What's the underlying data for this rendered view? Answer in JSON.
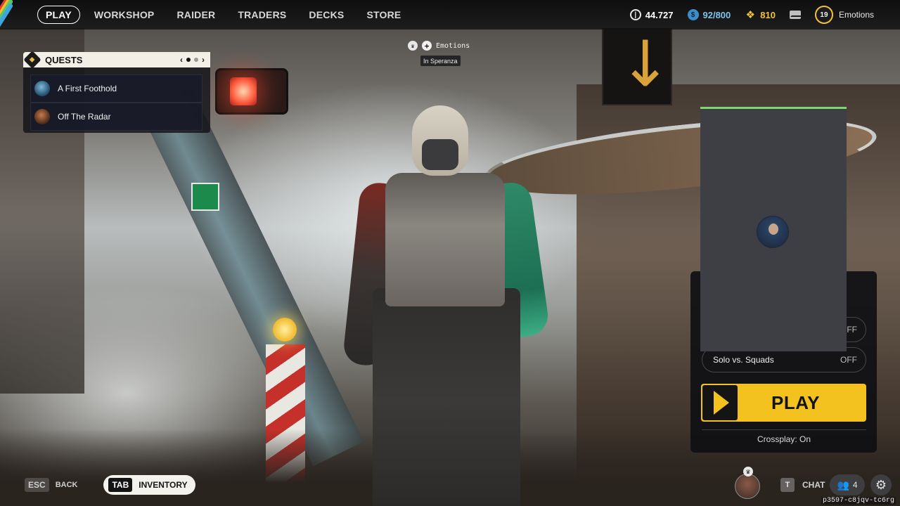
{
  "nav": {
    "items": [
      "PLAY",
      "WORKSHOP",
      "RAIDER",
      "TRADERS",
      "DECKS",
      "STORE"
    ],
    "active": "PLAY"
  },
  "currencies": {
    "coins": "44.727",
    "blue": "92/800",
    "gold": "810"
  },
  "profile": {
    "level": "19",
    "name": "Emotions"
  },
  "quests": {
    "title": "QUESTS",
    "items": [
      {
        "label": "A First Foothold"
      },
      {
        "label": "Off The Radar"
      }
    ]
  },
  "lobby": {
    "player_name": "Emotions",
    "location": "In Speranza"
  },
  "play_panel": {
    "options": [
      {
        "label": "",
        "state": "OFF"
      },
      {
        "label": "Solo vs. Squads",
        "state": "OFF"
      }
    ],
    "play_label": "PLAY",
    "crossplay": "Crossplay: On"
  },
  "bottom": {
    "esc_key": "ESC",
    "back_label": "BACK",
    "tab_key": "TAB",
    "inventory_label": "INVENTORY",
    "chat_key": "T",
    "chat_label": "CHAT",
    "party_count": "4",
    "session_id": "p3597-c8jqv-tc6rg"
  },
  "colors": {
    "accent_yellow": "#f3c21f",
    "currency_blue": "#7fc4e8",
    "currency_gold": "#f0c23c",
    "squad_card_top": "#7bd86e"
  },
  "icons": {
    "coins": "coins-icon",
    "blue_currency": "blue-token-icon",
    "gold_currency": "gold-token-icon",
    "mail": "mail-icon",
    "quest_header": "quest-diamond-icon",
    "party": "people-icon",
    "settings": "gear-icon"
  }
}
